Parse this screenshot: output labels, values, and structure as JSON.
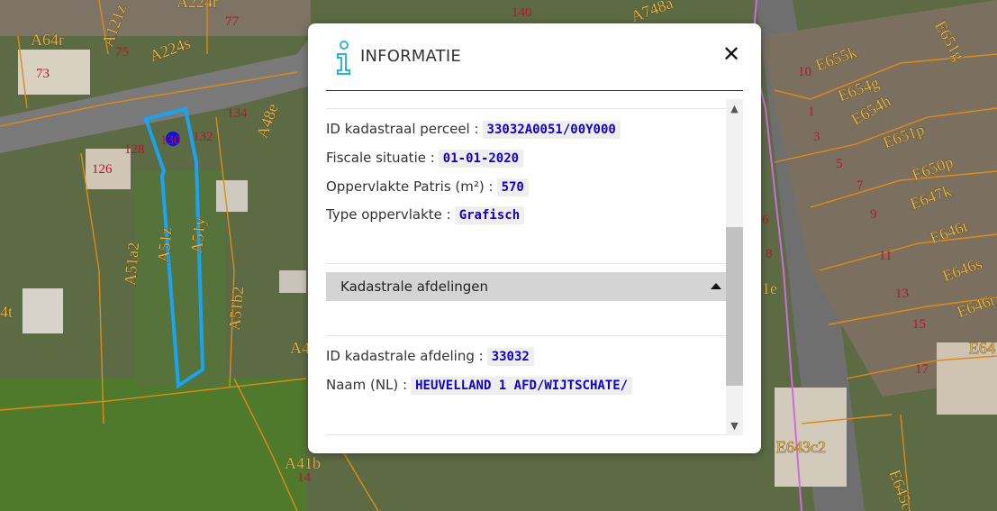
{
  "map": {
    "parcel_labels": [
      "A64r",
      "73",
      "A121z",
      "75",
      "A224s",
      "A224r",
      "77",
      "140",
      "A748a",
      "128",
      "130",
      "132",
      "134",
      "A48e",
      "126",
      "A51a2",
      "A51z",
      "A51y",
      "A51b2",
      "A41b",
      "14",
      "A4",
      "4t",
      "10",
      "1",
      "3",
      "5",
      "7",
      "9",
      "11",
      "13",
      "15",
      "17",
      "E655k",
      "E654g",
      "E654h",
      "E651p",
      "E650p",
      "E647k",
      "E646t",
      "E646s",
      "E646r",
      "E64",
      "E651g",
      "E643c2",
      "6",
      "8",
      "1e",
      "E645c"
    ]
  },
  "colors": {
    "parcel_outline": "#e08a16",
    "selected_parcel": "#1aa3f0",
    "marker": "#1010e0",
    "boundary": "#cf6be0",
    "parcel_number": "#c0112e"
  },
  "panel": {
    "title": "INFORMATIE",
    "icon": "info-icon",
    "close_icon": "close-icon",
    "parcel": {
      "id_label": "ID kadastraal perceel :",
      "id_value": "33032A0051/00Y000",
      "fiscal_label": "Fiscale situatie :",
      "fiscal_value": "01-01-2020",
      "area_label": "Oppervlakte Patris (m²) :",
      "area_value": "570",
      "type_label": "Type oppervlakte :",
      "type_value": "Grafisch"
    },
    "section": {
      "title": "Kadastrale afdelingen",
      "afdeling_label": "ID kadastrale afdeling :",
      "afdeling_value": "33032",
      "naam_label": "Naam (NL) :",
      "naam_value": "HEUVELLAND 1 AFD/WIJTSCHATE/"
    }
  }
}
